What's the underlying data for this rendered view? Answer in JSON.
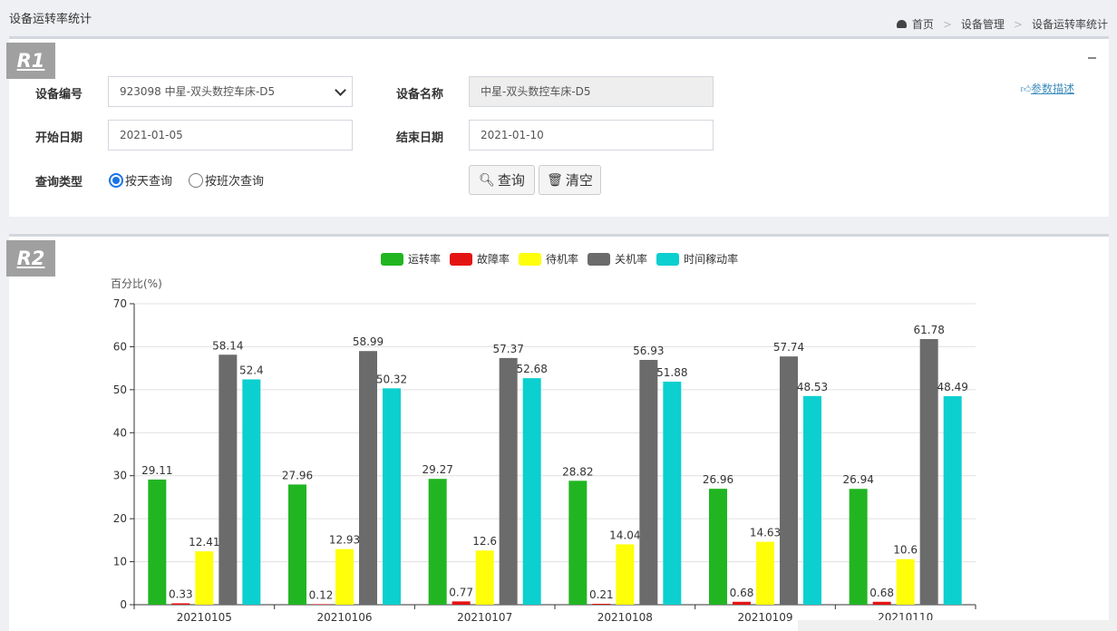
{
  "header": {
    "title": "设备运转率统计",
    "breadcrumb": [
      "首页",
      "设备管理",
      "设备运转率统计"
    ]
  },
  "panel1": {
    "badge": "R1",
    "param_link": "参数描述",
    "device_no_label": "设备编号",
    "device_no_value": "923098 中星-双头数控车床-D5",
    "device_name_label": "设备名称",
    "device_name_value": "中星-双头数控车床-D5",
    "start_label": "开始日期",
    "start_value": "2021-01-05",
    "end_label": "结束日期",
    "end_value": "2021-01-10",
    "query_type_label": "查询类型",
    "radio_day": "按天查询",
    "radio_shift": "按班次查询",
    "query_button": "查询",
    "clear_button": "清空"
  },
  "panel2": {
    "badge": "R2"
  },
  "colors": {
    "运转率": "#22b522",
    "故障率": "#e41414",
    "待机率": "#ffff0a",
    "关机率": "#6b6b6b",
    "时间稼动率": "#0ccfcf"
  },
  "chart_data": {
    "type": "bar",
    "ylabel": "百分比(%)",
    "ylim": [
      0,
      70
    ],
    "yticks": [
      0,
      10,
      20,
      30,
      40,
      50,
      60,
      70
    ],
    "grid": true,
    "legend_position": "top-center",
    "categories": [
      "20210105",
      "20210106",
      "20210107",
      "20210108",
      "20210109",
      "20210110"
    ],
    "series": [
      {
        "name": "运转率",
        "values": [
          29.11,
          27.96,
          29.27,
          28.82,
          26.96,
          26.94
        ]
      },
      {
        "name": "故障率",
        "values": [
          0.33,
          0.12,
          0.77,
          0.21,
          0.68,
          0.68
        ]
      },
      {
        "name": "待机率",
        "values": [
          12.41,
          12.93,
          12.6,
          14.04,
          14.63,
          10.6
        ]
      },
      {
        "name": "关机率",
        "values": [
          58.14,
          58.99,
          57.37,
          56.93,
          57.74,
          61.78
        ]
      },
      {
        "name": "时间稼动率",
        "values": [
          52.4,
          50.32,
          52.68,
          51.88,
          48.53,
          48.49
        ]
      }
    ]
  }
}
